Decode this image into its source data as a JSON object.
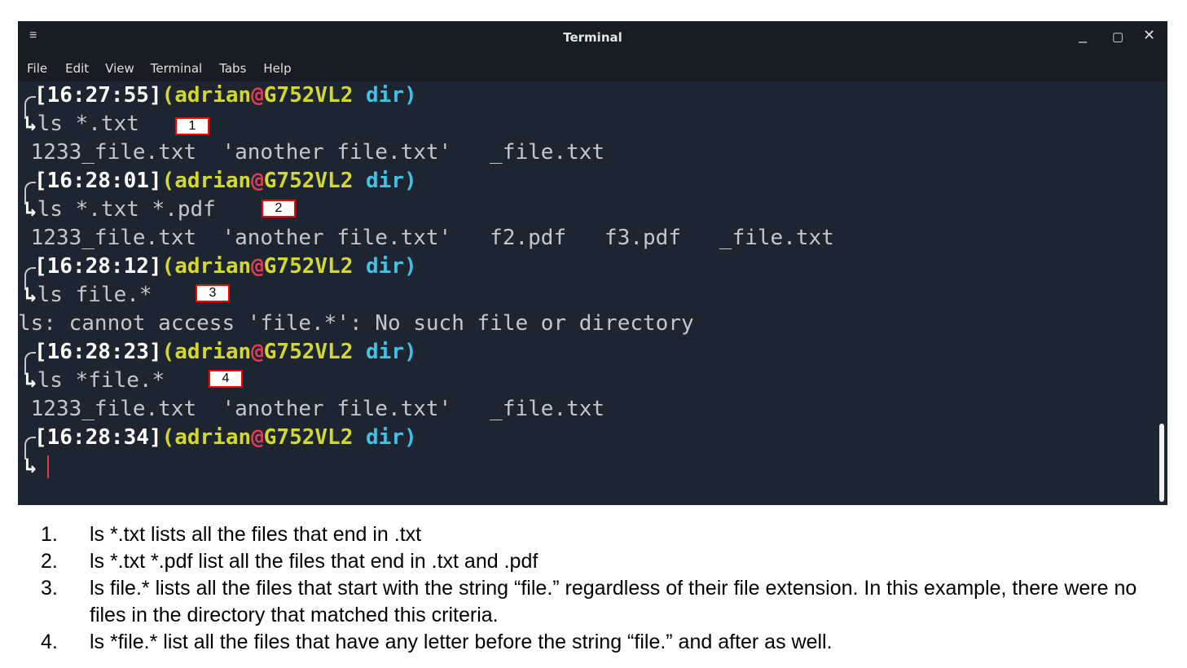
{
  "window": {
    "title": "Terminal",
    "menu": [
      "File",
      "Edit",
      "View",
      "Terminal",
      "Tabs",
      "Help"
    ],
    "controls": [
      "minimize-icon",
      "maximize-icon",
      "close-icon"
    ]
  },
  "prompts": [
    {
      "time": "[16:27:55]",
      "user": "(adrian",
      "at": "@",
      "host": "G752VL2",
      "dir": "dir)"
    },
    {
      "time": "[16:28:01]",
      "user": "(adrian",
      "at": "@",
      "host": "G752VL2",
      "dir": "dir)"
    },
    {
      "time": "[16:28:12]",
      "user": "(adrian",
      "at": "@",
      "host": "G752VL2",
      "dir": "dir)"
    },
    {
      "time": "[16:28:23]",
      "user": "(adrian",
      "at": "@",
      "host": "G752VL2",
      "dir": "dir)"
    },
    {
      "time": "[16:28:34]",
      "user": "(adrian",
      "at": "@",
      "host": "G752VL2",
      "dir": "dir)"
    }
  ],
  "commands": [
    "ls *.txt",
    "ls *.txt *.pdf",
    "ls file.*",
    "ls *file.*"
  ],
  "outputs": [
    " 1233_file.txt  'another file.txt'   _file.txt",
    " 1233_file.txt  'another file.txt'   f2.pdf   f3.pdf   _file.txt",
    "ls: cannot access 'file.*': No such file or directory",
    " 1233_file.txt  'another file.txt'   _file.txt"
  ],
  "markers": [
    "1",
    "2",
    "3",
    "4"
  ],
  "notes": [
    {
      "num": "1.",
      "text": "ls *.txt lists all the files that end in .txt"
    },
    {
      "num": "2.",
      "text": "ls *.txt *.pdf list all the files that end in .txt and .pdf"
    },
    {
      "num": "3.",
      "text": "ls file.* lists all the files that start with the string “file.” regardless of their file extension. In this example, there were no files in the directory that matched this criteria."
    },
    {
      "num": "4.",
      "text": "ls *file.* list all the files that have any letter before the string “file.” and after as well."
    }
  ],
  "colors": {
    "background": "#1c2530",
    "time": "#ffffff",
    "user": "#d4d82e",
    "at": "#e03b55",
    "dir": "#3ec2ea",
    "text": "#c2c7cc"
  }
}
